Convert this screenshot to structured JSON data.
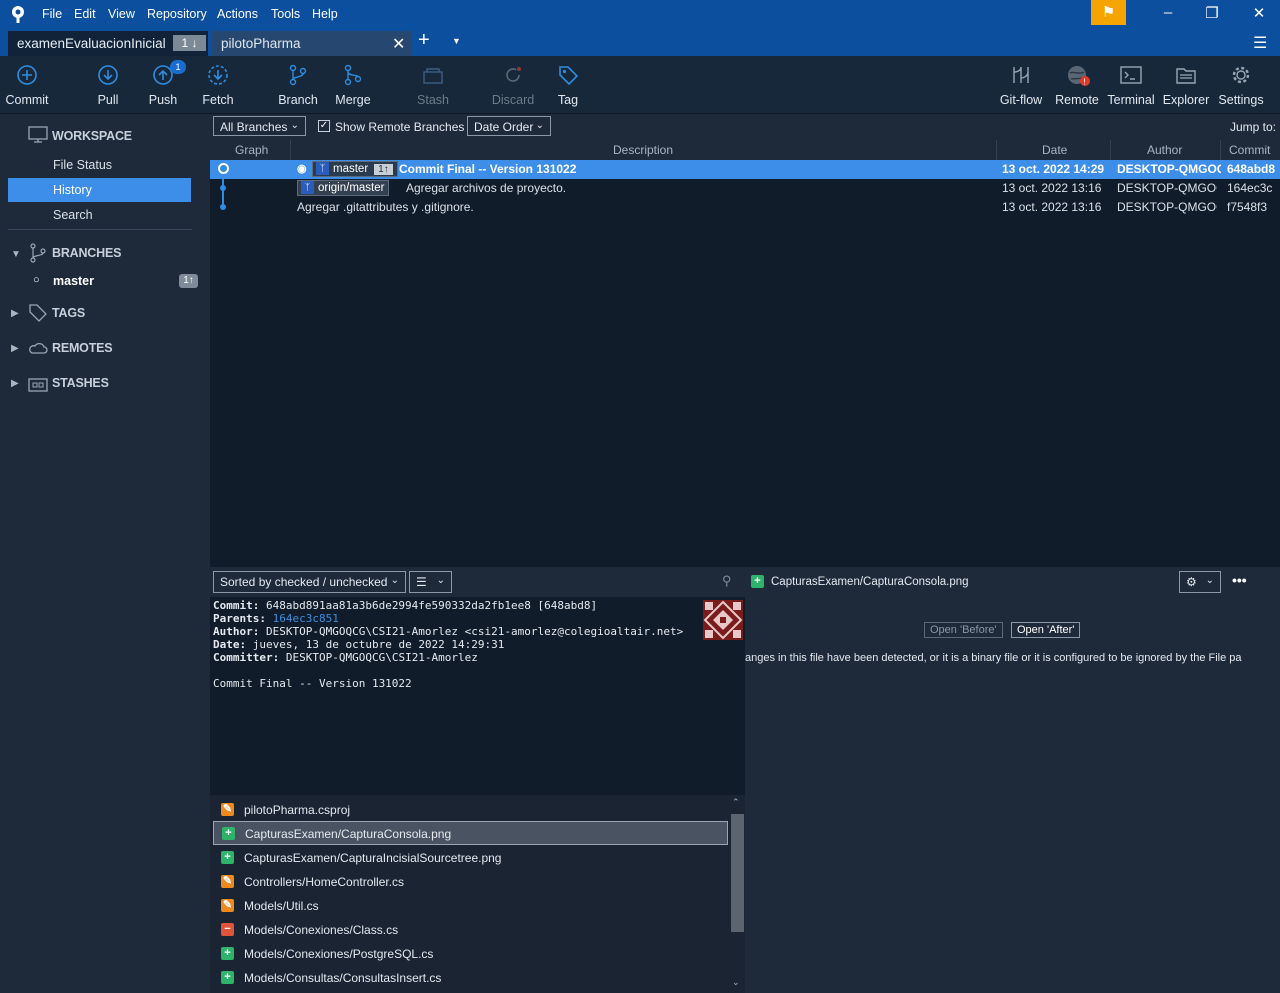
{
  "menu": [
    "File",
    "Edit",
    "View",
    "Repository",
    "Actions",
    "Tools",
    "Help"
  ],
  "tabs": [
    {
      "label": "examenEvaluacionInicial",
      "badge": "1 ↓"
    },
    {
      "label": "pilotoPharma"
    }
  ],
  "toolbar": {
    "commit": "Commit",
    "pull": "Pull",
    "push": "Push",
    "push_badge": "1",
    "fetch": "Fetch",
    "branch": "Branch",
    "merge": "Merge",
    "stash": "Stash",
    "discard": "Discard",
    "tag": "Tag",
    "gitflow": "Git-flow",
    "remote": "Remote",
    "terminal": "Terminal",
    "explorer": "Explorer",
    "settings": "Settings"
  },
  "sidebar": {
    "workspace": "WORKSPACE",
    "file_status": "File Status",
    "history": "History",
    "search": "Search",
    "branches": "BRANCHES",
    "master": "master",
    "master_badge": "1↑",
    "tags": "TAGS",
    "remotes": "REMOTES",
    "stashes": "STASHES"
  },
  "filter": {
    "branches": "All Branches",
    "show_remote": "Show Remote Branches",
    "order": "Date Order",
    "jump": "Jump to:"
  },
  "columns": {
    "graph": "Graph",
    "description": "Description",
    "date": "Date",
    "author": "Author",
    "commit": "Commit"
  },
  "commits": [
    {
      "ref": "master",
      "ref_badge": "1↑",
      "description": "Commit Final -- Version 131022",
      "date": "13 oct. 2022 14:29",
      "author": "DESKTOP-QMGOQCG",
      "hash": "648abd8"
    },
    {
      "ref": "origin/master",
      "description": "Agregar archivos de proyecto.",
      "date": "13 oct. 2022 13:16",
      "author": "DESKTOP-QMGOQ",
      "hash": "164ec3c"
    },
    {
      "description": "Agregar .gitattributes y .gitignore.",
      "date": "13 oct. 2022 13:16",
      "author": "DESKTOP-QMGOQ",
      "hash": "f7548f3"
    }
  ],
  "lower": {
    "sort": "Sorted by checked / unchecked",
    "file_header": "CapturasExamen/CapturaConsola.png"
  },
  "details": {
    "commit_label": "Commit:",
    "commit_val": "648abd891aa81a3b6de2994fe590332da2fb1ee8 [648abd8]",
    "parents_label": "Parents:",
    "parents_val": "164ec3c851",
    "author_label": "Author:",
    "author_val": "DESKTOP-QMGOQCG\\CSI21-Amorlez <csi21-amorlez@colegioaltair.net>",
    "date_label": "Date:",
    "date_val": "jueves, 13 de octubre de 2022 14:29:31",
    "committer_label": "Committer:",
    "committer_val": "DESKTOP-QMGOQCG\\CSI21-Amorlez",
    "message": "Commit Final -- Version 131022"
  },
  "files": [
    {
      "name": "pilotoPharma.csproj",
      "status": "modified"
    },
    {
      "name": "CapturasExamen/CapturaConsola.png",
      "status": "added"
    },
    {
      "name": "CapturasExamen/CapturaIncisialSourcetree.png",
      "status": "added"
    },
    {
      "name": "Controllers/HomeController.cs",
      "status": "modified"
    },
    {
      "name": "Models/Util.cs",
      "status": "modified"
    },
    {
      "name": "Models/Conexiones/Class.cs",
      "status": "removed"
    },
    {
      "name": "Models/Conexiones/PostgreSQL.cs",
      "status": "added"
    },
    {
      "name": "Models/Consultas/ConsultasInsert.cs",
      "status": "added"
    }
  ],
  "diff": {
    "open_before": "Open 'Before'",
    "open_after": "Open 'After'",
    "message": "anges in this file have been detected, or it is a binary file or it is configured to be ignored by the File pa"
  },
  "colors": {
    "titlebar": "#0b4f9e",
    "selection": "#3d8ee8",
    "added": "#2fb26a",
    "modified": "#f08a1c",
    "removed": "#e0553a",
    "flag": "#f5a400"
  }
}
